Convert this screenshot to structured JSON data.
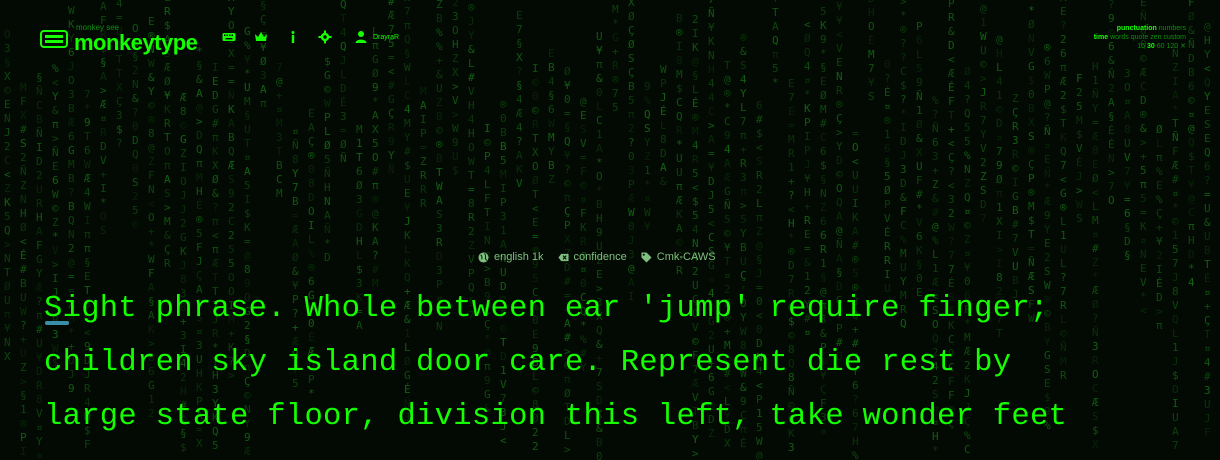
{
  "theme": {
    "accent": "#15ff00",
    "background": "#030a03",
    "rain": "#1d9a1d",
    "caret": "#3a8fa8"
  },
  "header": {
    "logo_top": "monkey see",
    "logo_main": "monkeytype",
    "nav_icons": [
      "keyboard-icon",
      "crown-icon",
      "info-icon",
      "gear-icon",
      "user-icon"
    ],
    "username": "DrayraR"
  },
  "config": {
    "modifiers": [
      "punctuation",
      "numbers"
    ],
    "modes": [
      "time",
      "words",
      "quote",
      "zen",
      "custom"
    ],
    "times": [
      "15",
      "30",
      "60",
      "120"
    ],
    "active_time": "30"
  },
  "test_info": {
    "language": "english 1k",
    "difficulty": "confidence",
    "layout": "Cmk-CAWS"
  },
  "words": {
    "lines": [
      "Sight phrase. Whole between ear 'jump' require finger;",
      "children sky island door care. Represent die rest by",
      "large state floor, division this left, take wonder feet"
    ]
  }
}
